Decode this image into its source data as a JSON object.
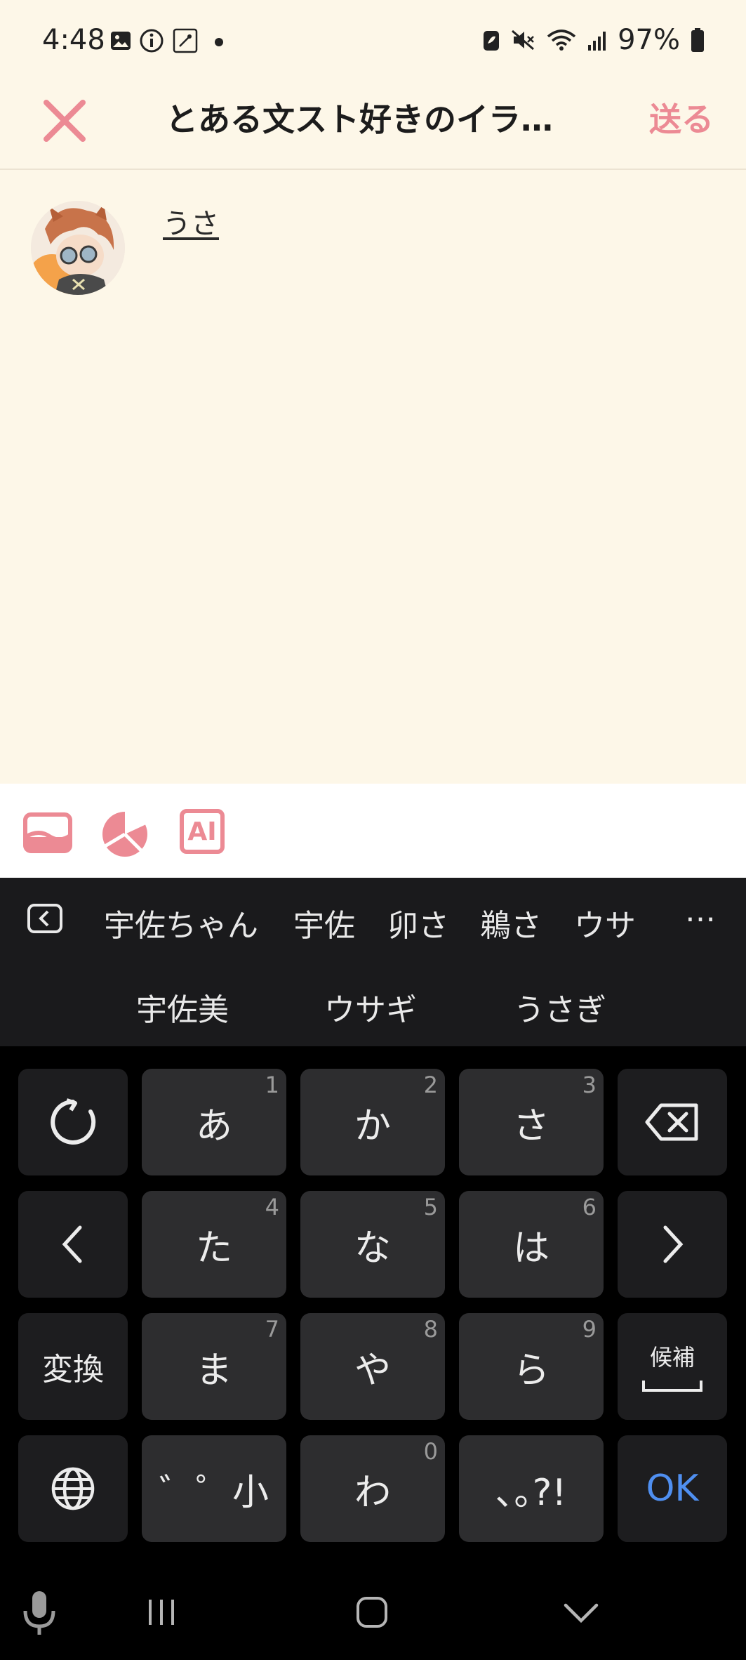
{
  "status_bar": {
    "time": "4:48",
    "battery": "97%",
    "icons": [
      "image-icon",
      "info-icon",
      "app-icon",
      "dot-icon",
      "battery-saver-icon",
      "mute-icon",
      "wifi-icon",
      "signal-icon",
      "battery-icon"
    ]
  },
  "header": {
    "title": "とある文スト好きのイラ…",
    "send_label": "送る",
    "close_icon": "close-icon"
  },
  "post": {
    "author_name": "うさ"
  },
  "toolbar": {
    "icons": [
      "image-icon",
      "poll-icon",
      "ai-icon"
    ],
    "ai_label": "AI"
  },
  "keyboard": {
    "candidates_row1": [
      "宇佐ちゃん",
      "宇佐",
      "卯さ",
      "鵜さ",
      "ウサ"
    ],
    "candidates_row2": [
      "宇佐美",
      "ウサギ",
      "うさぎ"
    ],
    "more": "…",
    "keys": {
      "a": {
        "label": "あ",
        "num": "1"
      },
      "ka": {
        "label": "か",
        "num": "2"
      },
      "sa": {
        "label": "さ",
        "num": "3"
      },
      "ta": {
        "label": "た",
        "num": "4"
      },
      "na": {
        "label": "な",
        "num": "5"
      },
      "ha": {
        "label": "は",
        "num": "6"
      },
      "ma": {
        "label": "ま",
        "num": "7"
      },
      "ya": {
        "label": "や",
        "num": "8"
      },
      "ra": {
        "label": "ら",
        "num": "9"
      },
      "dakuten": {
        "label": "゛゜小"
      },
      "wa": {
        "label": "わ",
        "num": "0"
      },
      "punct": {
        "label": "､｡?!"
      },
      "henkan": "変換",
      "kouho": "候補",
      "ok": "OK"
    }
  },
  "colors": {
    "accent": "#ec8a94",
    "app_bg": "#fdf7e8",
    "keyboard_bg": "#1a1a1c",
    "key_bg": "#2d2d2f",
    "ok_blue": "#4f8ff0"
  }
}
